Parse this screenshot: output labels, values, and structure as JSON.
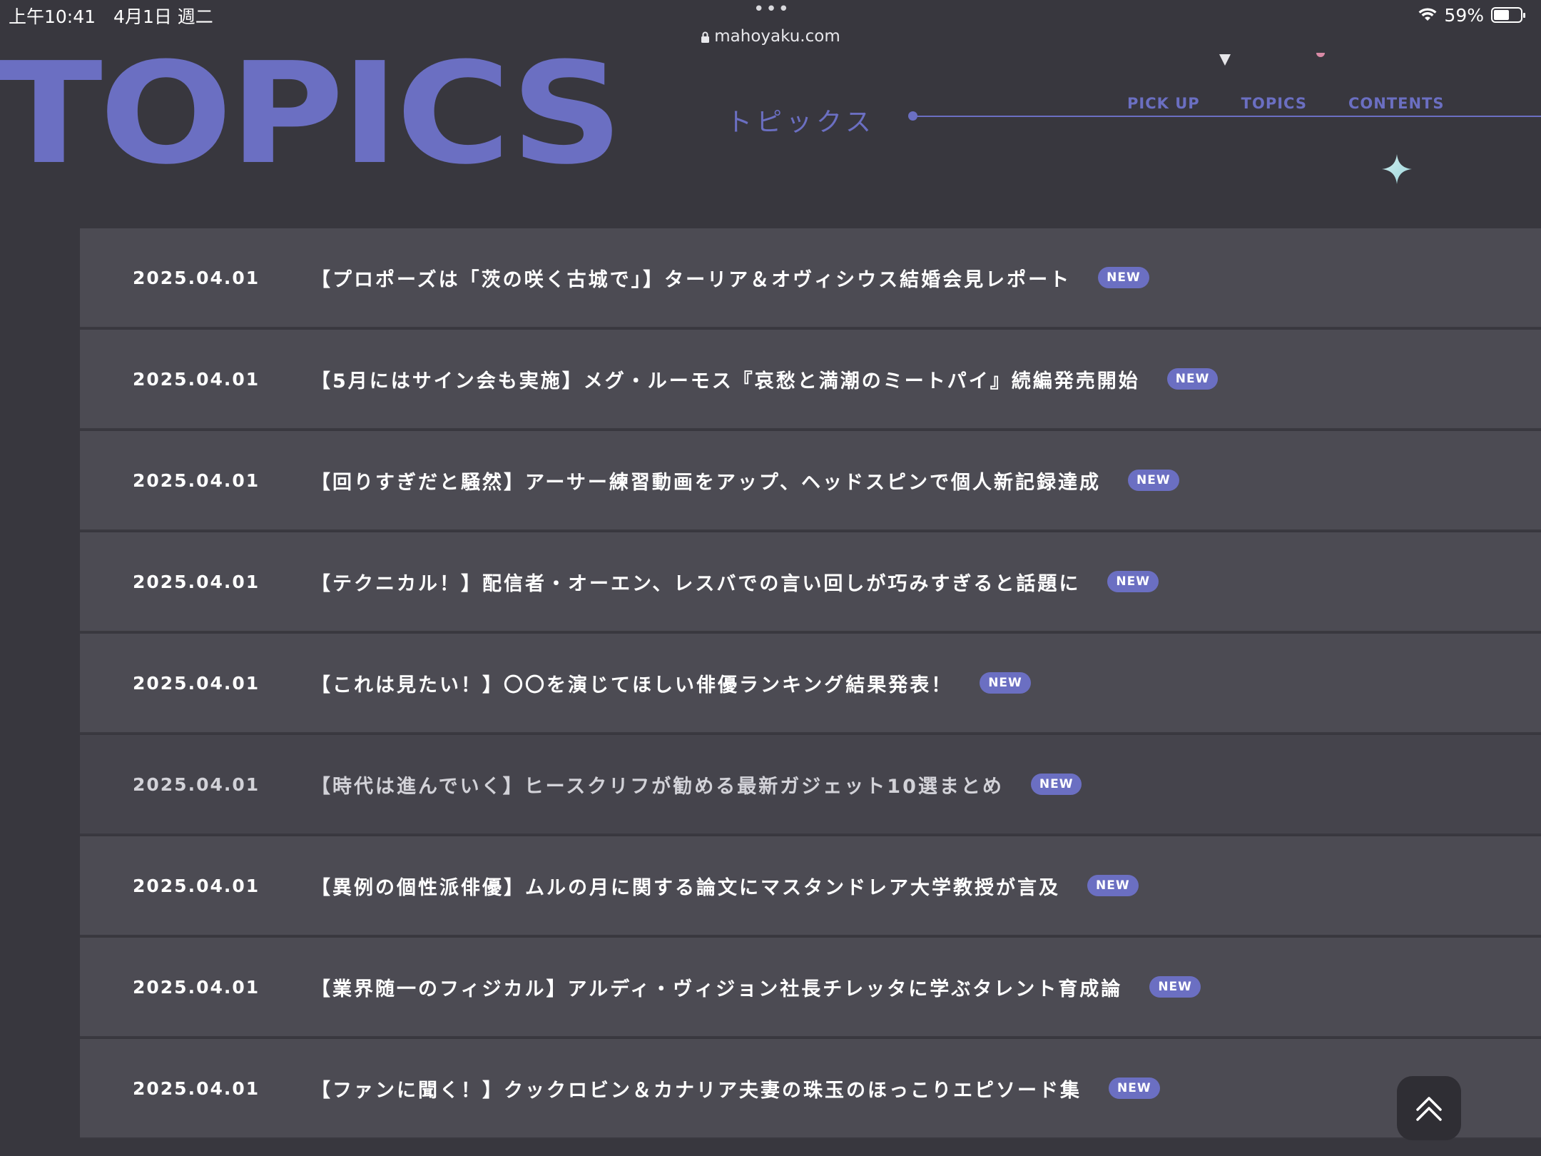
{
  "status_bar": {
    "time": "上午10:41　4月1日 週二",
    "dots": "•••",
    "battery_percent": "59%",
    "battery_level": 0.59
  },
  "url_bar": {
    "domain": "mahoyaku.com"
  },
  "hero": {
    "title": "TOPICS",
    "subtitle": "トピックス"
  },
  "nav": {
    "items": [
      "PICK UP",
      "TOPICS",
      "CONTENTS"
    ]
  },
  "colors": {
    "accent": "#6b6fc2",
    "background": "#38373e",
    "row": "#4c4b53"
  },
  "topics": [
    {
      "date": "2025.04.01",
      "title": "【プロポーズは「茨の咲く古城で」】ターリア＆オヴィシウス結婚会見レポート",
      "badge": "NEW"
    },
    {
      "date": "2025.04.01",
      "title": "【5月にはサイン会も実施】メグ・ルーモス『哀愁と満潮のミートパイ』続編発売開始",
      "badge": "NEW"
    },
    {
      "date": "2025.04.01",
      "title": "【回りすぎだと騒然】アーサー練習動画をアップ、ヘッドスピンで個人新記録達成",
      "badge": "NEW"
    },
    {
      "date": "2025.04.01",
      "title": "【テクニカル！】配信者・オーエン、レスバでの言い回しが巧みすぎると話題に",
      "badge": "NEW"
    },
    {
      "date": "2025.04.01",
      "title": "【これは見たい！】〇〇を演じてほしい俳優ランキング結果発表！",
      "badge": "NEW"
    },
    {
      "date": "2025.04.01",
      "title": "【時代は進んでいく】ヒースクリフが勧める最新ガジェット10選まとめ",
      "badge": "NEW"
    },
    {
      "date": "2025.04.01",
      "title": "【異例の個性派俳優】ムルの月に関する論文にマスタンドレア大学教授が言及",
      "badge": "NEW"
    },
    {
      "date": "2025.04.01",
      "title": "【業界随一のフィジカル】アルディ・ヴィジョン社長チレッタに学ぶタレント育成論",
      "badge": "NEW"
    },
    {
      "date": "2025.04.01",
      "title": "【ファンに聞く！】クックロビン＆カナリア夫妻の珠玉のほっこりエピソード集",
      "badge": "NEW"
    }
  ],
  "icons": {
    "back_to_top": "double-chevron-up-icon",
    "sparkle": "sparkle-icon",
    "lock": "lock-icon",
    "wifi": "wifi-icon",
    "battery": "battery-icon"
  }
}
